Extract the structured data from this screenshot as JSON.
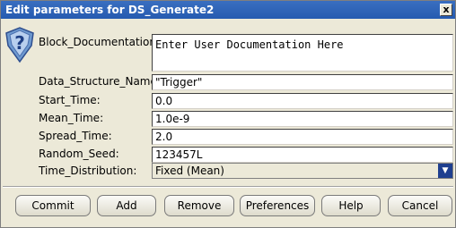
{
  "window": {
    "title": "Edit parameters for DS_Generate2",
    "close_glyph": "x"
  },
  "icons": {
    "help": "help-question-icon"
  },
  "fields": {
    "block_documentation": {
      "label": "Block_Documentation:",
      "value": "Enter User Documentation Here"
    },
    "data_structure_name": {
      "label": "Data_Structure_Name",
      "value": "\"Trigger\""
    },
    "start_time": {
      "label": "Start_Time:",
      "value": "0.0"
    },
    "mean_time": {
      "label": "Mean_Time:",
      "value": "1.0e-9"
    },
    "spread_time": {
      "label": "Spread_Time:",
      "value": "2.0"
    },
    "random_seed": {
      "label": "Random_Seed:",
      "value": "123457L"
    },
    "time_distribution": {
      "label": "Time_Distribution:",
      "value": "Fixed (Mean)"
    }
  },
  "buttons": {
    "commit": "Commit",
    "add": "Add",
    "remove": "Remove",
    "preferences": "Preferences",
    "help": "Help",
    "cancel": "Cancel"
  },
  "colors": {
    "titlebar": "#255bb0",
    "background": "#ece9d8",
    "dropdown_arrow": "#1f3f8f"
  }
}
